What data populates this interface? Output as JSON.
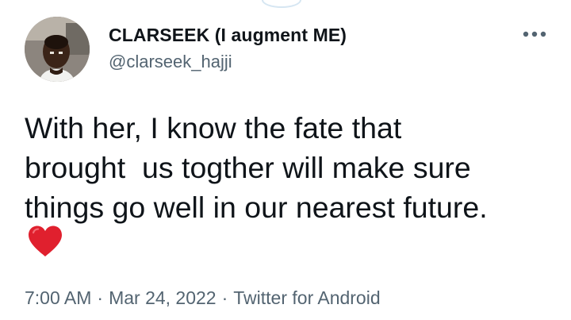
{
  "tweet": {
    "display_name": "CLARSEEK (I augment ME)",
    "handle": "@clarseek_hajji",
    "text": "With her, I know the fate that\nbrought  us togther will make sure\nthings go well in our nearest future.",
    "emoji": "heart",
    "time": "7:00 AM",
    "separator": "·",
    "date": "Mar 24, 2022",
    "source": "Twitter for Android"
  },
  "icons": {
    "more": "more-horizontal-icon",
    "heart": "red-heart-icon"
  },
  "colors": {
    "text_primary": "#0f1419",
    "text_secondary": "#536471",
    "heart": "#e0202e"
  }
}
